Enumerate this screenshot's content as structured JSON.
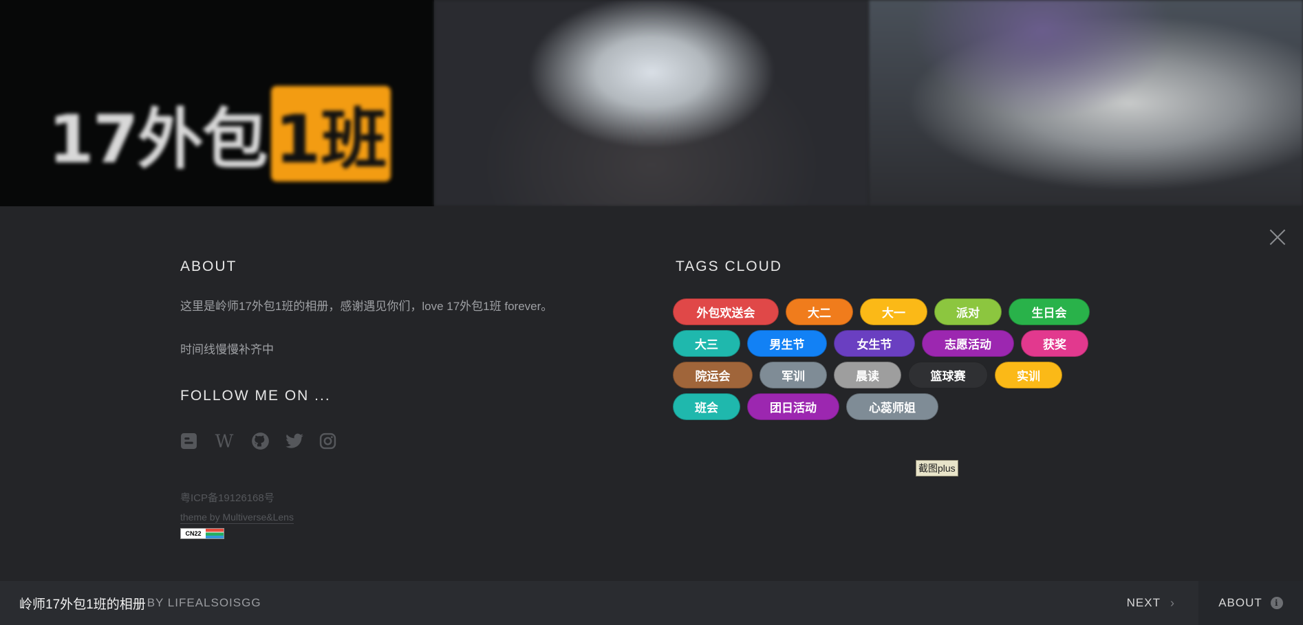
{
  "hero": {
    "logo_white": "17外包",
    "logo_orange": "1班"
  },
  "about": {
    "heading": "ABOUT",
    "text": "这里是岭师17外包1班的相册，感谢遇见你们，love 17外包1班 forever。",
    "text2": "时间线慢慢补齐中"
  },
  "follow": {
    "heading": "FOLLOW ME ON ...",
    "icons": [
      "blogger-icon",
      "wikipedia-icon",
      "github-icon",
      "twitter-icon",
      "instagram-icon"
    ]
  },
  "footer_info": {
    "icp": "粤ICP备19126168号",
    "theme": "theme by Multiverse&Lens",
    "badge": "CN22"
  },
  "tags_cloud": {
    "heading": "TAGS CLOUD",
    "tags": [
      {
        "label": "外包欢送会",
        "color": "#e04848"
      },
      {
        "label": "大二",
        "color": "#f07c1c"
      },
      {
        "label": "大一",
        "color": "#fbb917"
      },
      {
        "label": "派对",
        "color": "#8cc63f"
      },
      {
        "label": "生日会",
        "color": "#29b24a"
      },
      {
        "label": "大三",
        "color": "#1fb8ad"
      },
      {
        "label": "男生节",
        "color": "#1281f5"
      },
      {
        "label": "女生节",
        "color": "#6a3fc1"
      },
      {
        "label": "志愿活动",
        "color": "#9c27b0"
      },
      {
        "label": "获奖",
        "color": "#e2398e"
      },
      {
        "label": "院运会",
        "color": "#a0653a"
      },
      {
        "label": "军训",
        "color": "#7f8c96"
      },
      {
        "label": "晨读",
        "color": "#9e9e9e"
      },
      {
        "label": "篮球赛",
        "color": "#2f3033"
      },
      {
        "label": "实训",
        "color": "#fbb917"
      },
      {
        "label": "班会",
        "color": "#1fb8ad"
      },
      {
        "label": "团日活动",
        "color": "#9c27b0"
      },
      {
        "label": "心蕊师姐",
        "color": "#7f8c96"
      }
    ]
  },
  "watermark": "截图plus",
  "bottom_bar": {
    "title": "岭师17外包1班的相册",
    "by": "BY LIFEALSOISGG",
    "next": "NEXT",
    "about": "ABOUT"
  },
  "colors": {
    "overlay": "#242528",
    "bottom_bar": "#2a2c30",
    "logo_accent": "#f39c12"
  }
}
